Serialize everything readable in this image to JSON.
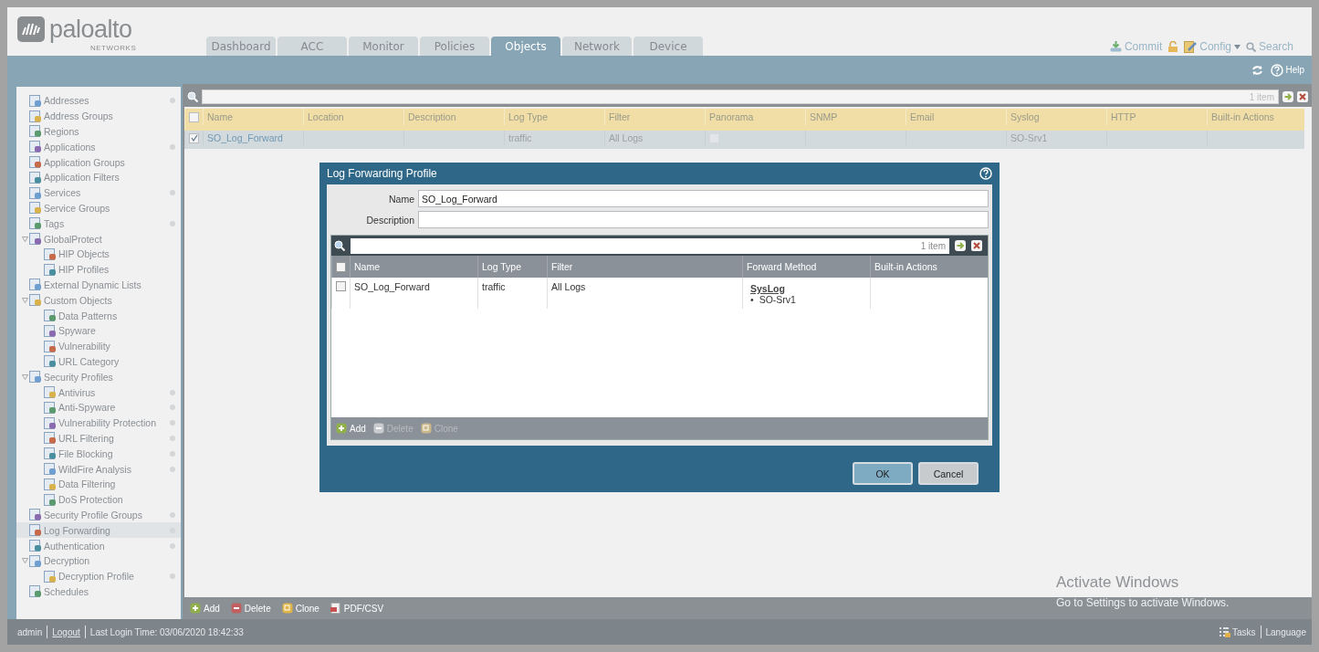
{
  "header": {
    "logo": {
      "wordmark": "paloalto",
      "tagline": "NETWORKS"
    },
    "tabs": [
      {
        "label": "Dashboard",
        "selected": false
      },
      {
        "label": "ACC",
        "selected": false
      },
      {
        "label": "Monitor",
        "selected": false
      },
      {
        "label": "Policies",
        "selected": false
      },
      {
        "label": "Objects",
        "selected": true
      },
      {
        "label": "Network",
        "selected": false
      },
      {
        "label": "Device",
        "selected": false
      }
    ],
    "links": [
      {
        "kind": "commit",
        "label": "Commit"
      },
      {
        "kind": "lock"
      },
      {
        "kind": "config",
        "label": "Config"
      },
      {
        "kind": "search",
        "label": "Search"
      }
    ]
  },
  "toolbar": {
    "help": "Help"
  },
  "sidebar": {
    "items": [
      {
        "label": "Addresses",
        "dot": true,
        "selected": false
      },
      {
        "label": "Address Groups",
        "dot": false,
        "selected": false
      },
      {
        "label": "Regions",
        "dot": false,
        "selected": false
      },
      {
        "label": "Applications",
        "dot": true,
        "selected": false
      },
      {
        "label": "Application Groups",
        "dot": false,
        "selected": false
      },
      {
        "label": "Application Filters",
        "dot": false,
        "selected": false
      },
      {
        "label": "Services",
        "dot": true,
        "selected": false
      },
      {
        "label": "Service Groups",
        "dot": false,
        "selected": false
      },
      {
        "label": "Tags",
        "dot": true,
        "selected": false
      },
      {
        "label": "GlobalProtect",
        "dot": false,
        "selected": false,
        "expanded": true,
        "children": [
          {
            "label": "HIP Objects",
            "dot": false,
            "selected": false
          },
          {
            "label": "HIP Profiles",
            "dot": false,
            "selected": false
          }
        ]
      },
      {
        "label": "External Dynamic Lists",
        "dot": false,
        "selected": false
      },
      {
        "label": "Custom Objects",
        "dot": false,
        "selected": false,
        "expanded": true,
        "children": [
          {
            "label": "Data Patterns",
            "dot": false,
            "selected": false
          },
          {
            "label": "Spyware",
            "dot": false,
            "selected": false
          },
          {
            "label": "Vulnerability",
            "dot": false,
            "selected": false
          },
          {
            "label": "URL Category",
            "dot": false,
            "selected": false
          }
        ]
      },
      {
        "label": "Security Profiles",
        "dot": false,
        "selected": false,
        "expanded": true,
        "children": [
          {
            "label": "Antivirus",
            "dot": true,
            "selected": false
          },
          {
            "label": "Anti-Spyware",
            "dot": true,
            "selected": false
          },
          {
            "label": "Vulnerability Protection",
            "dot": true,
            "selected": false
          },
          {
            "label": "URL Filtering",
            "dot": true,
            "selected": false
          },
          {
            "label": "File Blocking",
            "dot": true,
            "selected": false
          },
          {
            "label": "WildFire Analysis",
            "dot": true,
            "selected": false
          },
          {
            "label": "Data Filtering",
            "dot": false,
            "selected": false
          },
          {
            "label": "DoS Protection",
            "dot": false,
            "selected": false
          }
        ]
      },
      {
        "label": "Security Profile Groups",
        "dot": true,
        "selected": false
      },
      {
        "label": "Log Forwarding",
        "dot": true,
        "selected": true
      },
      {
        "label": "Authentication",
        "dot": true,
        "selected": false
      },
      {
        "label": "Decryption",
        "dot": false,
        "selected": false,
        "expanded": true,
        "children": [
          {
            "label": "Decryption Profile",
            "dot": true,
            "selected": false
          }
        ]
      },
      {
        "label": "Schedules",
        "dot": false,
        "selected": false
      }
    ]
  },
  "filter_bar": {
    "count": "1 item"
  },
  "table": {
    "select_all_checked": false,
    "columns": [
      "Name",
      "Location",
      "Description",
      "Log Type",
      "Filter",
      "Panorama",
      "SNMP",
      "Email",
      "Syslog",
      "HTTP",
      "Built-in Actions"
    ],
    "rows": [
      {
        "checked": true,
        "name": "SO_Log_Forward",
        "log_type": "traffic",
        "filter": "All Logs",
        "panorama": false,
        "syslog": "SO-Srv1"
      }
    ]
  },
  "actions": [
    {
      "kind": "add",
      "label": "Add"
    },
    {
      "kind": "delete",
      "label": "Delete"
    },
    {
      "kind": "clone",
      "label": "Clone"
    },
    {
      "kind": "pdf",
      "label": "PDF/CSV"
    }
  ],
  "status_bar": {
    "user": "admin",
    "logout": "Logout",
    "last_login": "Last Login Time: 03/06/2020 18:42:33",
    "tasks": "Tasks",
    "language": "Language"
  },
  "windows_notice": {
    "title": "Activate Windows",
    "subtitle": "Go to Settings to activate Windows."
  },
  "dialog": {
    "title": "Log Forwarding Profile",
    "fields": [
      {
        "label": "Name",
        "value": "SO_Log_Forward"
      },
      {
        "label": "Description"
      }
    ],
    "filter_count": "1 item",
    "select_all_checked": false,
    "columns": [
      "Name",
      "Log Type",
      "Filter",
      "Forward Method",
      "Built-in Actions"
    ],
    "rows": [
      {
        "checked": false,
        "name": "SO_Log_Forward",
        "log_type": "traffic",
        "filter": "All Logs",
        "method": "SysLog",
        "bullet": "•",
        "servers": [
          "SO-Srv1"
        ]
      }
    ],
    "actions": [
      {
        "kind": "add",
        "label": "Add",
        "disabled": false
      },
      {
        "kind": "delete",
        "label": "Delete",
        "disabled": true
      },
      {
        "kind": "clone",
        "label": "Clone",
        "disabled": true
      }
    ],
    "buttons": [
      {
        "kind": "primary",
        "label": "OK"
      },
      {
        "kind": "secondary",
        "label": "Cancel"
      }
    ]
  }
}
